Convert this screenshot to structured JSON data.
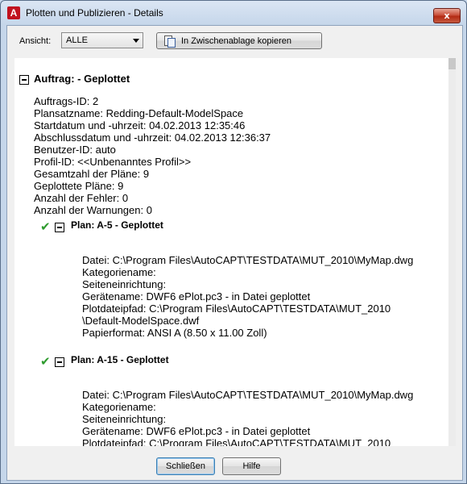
{
  "window": {
    "title": "Plotten und Publizieren - Details",
    "app_icon": "A",
    "close_label": "x"
  },
  "toolbar": {
    "view_label": "Ansicht:",
    "view_value": "ALLE",
    "copy_label": "In Zwischenablage kopieren"
  },
  "job": {
    "heading": "Auftrag: - Geplottet",
    "lines": [
      "Auftrags-ID: 2",
      "Plansatzname: Redding-Default-ModelSpace",
      "Startdatum und -uhrzeit: 04.02.2013 12:35:46",
      "Abschlussdatum und -uhrzeit: 04.02.2013 12:36:37",
      "Benutzer-ID: auto",
      "Profil-ID: <<Unbenanntes Profil>>",
      "Gesamtzahl der Pläne: 9",
      "Geplottete Pläne: 9",
      "Anzahl der Fehler: 0",
      "Anzahl der Warnungen: 0"
    ]
  },
  "plans": [
    {
      "heading": "Plan: A-5 - Geplottet",
      "lines": [
        "Datei: C:\\Program Files\\AutoCAPT\\TESTDATA\\MUT_2010\\MyMap.dwg",
        "Kategoriename:",
        "Seiteneinrichtung:",
        "Gerätename: DWF6 ePlot.pc3 - in Datei geplottet",
        "Plotdateipfad: C:\\Program Files\\AutoCAPT\\TESTDATA\\MUT_2010",
        "\\Default-ModelSpace.dwf",
        "Papierformat: ANSI A (8.50 x 11.00 Zoll)"
      ]
    },
    {
      "heading": "Plan: A-15 - Geplottet",
      "lines": [
        "Datei: C:\\Program Files\\AutoCAPT\\TESTDATA\\MUT_2010\\MyMap.dwg",
        "Kategoriename:",
        "Seiteneinrichtung:",
        "Gerätename: DWF6 ePlot.pc3 - in Datei geplottet",
        "Plotdateipfad: C:\\Program Files\\AutoCAPT\\TESTDATA\\MUT_2010"
      ]
    }
  ],
  "footer": {
    "close_label": "Schließen",
    "help_label": "Hilfe"
  },
  "colors": {
    "check": "#2e9b2e",
    "close_button": "#c9503b",
    "titlebar": "#c5d6ea"
  }
}
